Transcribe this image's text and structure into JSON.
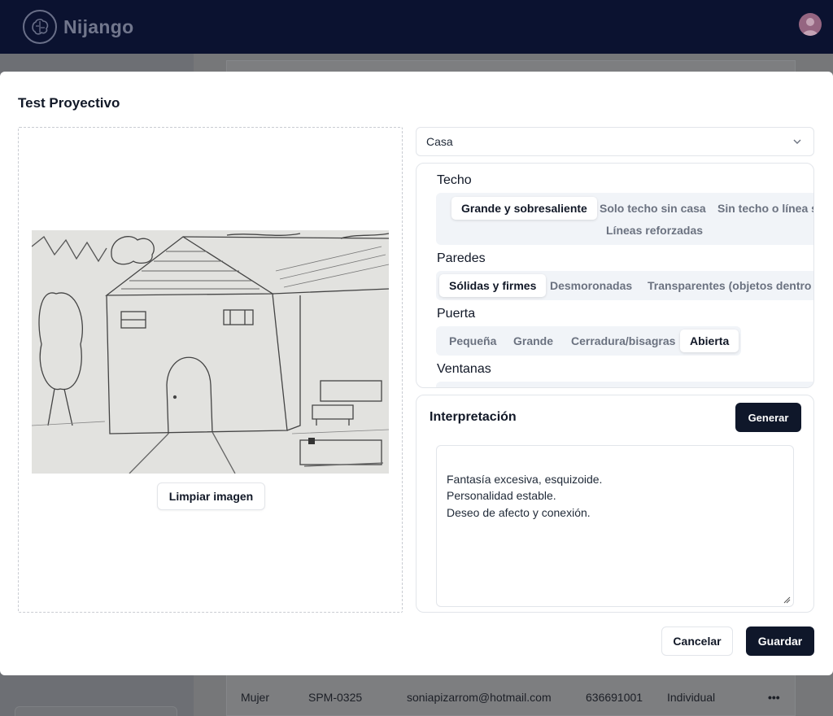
{
  "app": {
    "name": "Nijango"
  },
  "background_row": {
    "gender": "Mujer",
    "code": "SPM-0325",
    "email": "soniapizarrom@hotmail.com",
    "phone": "636691001",
    "type": "Individual",
    "menu": "•••"
  },
  "modal": {
    "title": "Test Proyectivo",
    "image": {
      "clear_label": "Limpiar imagen"
    },
    "select": {
      "value": "Casa"
    },
    "attributes": [
      {
        "label": "Techo",
        "options": [
          "Grande y sobresaliente",
          "Solo techo sin casa",
          "Sin techo o línea si",
          "Líneas reforzadas"
        ],
        "selected": "Grande y sobresaliente"
      },
      {
        "label": "Paredes",
        "options": [
          "Sólidas y firmes",
          "Desmoronadas",
          "Transparentes (objetos dentro vi"
        ],
        "selected": "Sólidas y firmes"
      },
      {
        "label": "Puerta",
        "options": [
          "Pequeña",
          "Grande",
          "Cerradura/bisagras",
          "Abierta"
        ],
        "selected": "Abierta"
      },
      {
        "label": "Ventanas"
      }
    ],
    "interpretation": {
      "title": "Interpretación",
      "generate_label": "Generar",
      "text": "Fantasía excesiva, esquizoide.\nPersonalidad estable.\nDeseo de afecto y conexión."
    },
    "footer": {
      "cancel_label": "Cancelar",
      "save_label": "Guardar"
    }
  },
  "colors": {
    "primary": "#0f172a",
    "topbar": "#0b1230",
    "segment_bg": "#f1f4f8",
    "border": "#e2e5ea"
  },
  "icons": [
    "brain-logo-icon",
    "avatar-icon",
    "chevron-down-icon",
    "resize-grip-icon"
  ]
}
